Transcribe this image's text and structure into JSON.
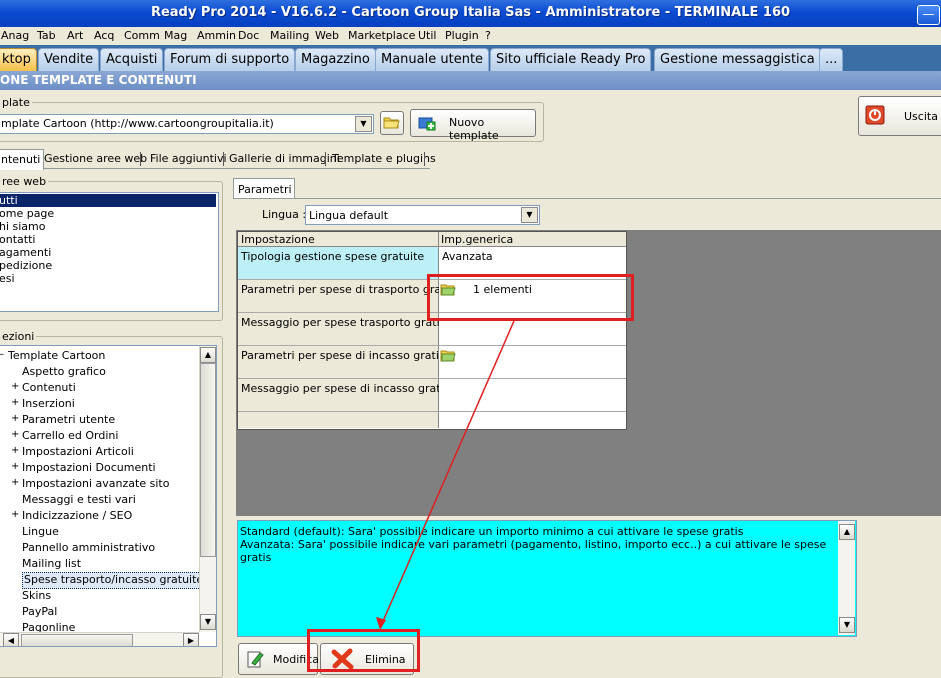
{
  "window": {
    "title": "Ready Pro 2014 - V16.6.2 - Cartoon Group Italia Sas - Amministratore - TERMINALE 160",
    "minimize_icon": "minimize-icon"
  },
  "menu": [
    "Anag",
    "Tab",
    "Art",
    "Acq",
    "Comm",
    "Mag",
    "Ammin",
    "Doc",
    "Mailing",
    "Web",
    "Marketplace",
    "Util",
    "Plugin",
    "?"
  ],
  "menu_accel": [
    "A",
    "T",
    "r",
    "q",
    "C",
    "M",
    "m",
    "D",
    "M",
    "W",
    "k",
    "U",
    "P",
    "?"
  ],
  "app_tabs": [
    "ktop",
    "Vendite",
    "Acquisti",
    "Forum di supporto",
    "Magazzino",
    "Manuale utente",
    "Sito ufficiale Ready Pro",
    "Gestione messaggistica",
    "..."
  ],
  "section_title": "ONE TEMPLATE E CONTENUTI",
  "template_group": {
    "legend": "plate",
    "combo_value": "mplate Cartoon (http://www.cartoongroupitalia.it)",
    "new_template_label": "Nuovo template"
  },
  "exit_label": "Uscita",
  "subtabs": [
    "ntenuti",
    "Gestione aree web",
    "File aggiuntivi",
    "Gallerie di immagini",
    "Template e plugins"
  ],
  "aree_web": {
    "legend": "ree web",
    "items": [
      "utti",
      "ome page",
      "hi siamo",
      "ontatti",
      "agamenti",
      "pedizione",
      "esi"
    ]
  },
  "sezioni": {
    "legend": "ezioni",
    "root": "Template Cartoon",
    "items": [
      {
        "label": "Aspetto grafico",
        "expandable": false
      },
      {
        "label": "Contenuti",
        "expandable": true
      },
      {
        "label": "Inserzioni",
        "expandable": true
      },
      {
        "label": "Parametri utente",
        "expandable": true
      },
      {
        "label": "Carrello ed Ordini",
        "expandable": true
      },
      {
        "label": "Impostazioni Articoli",
        "expandable": true
      },
      {
        "label": "Impostazioni Documenti",
        "expandable": true
      },
      {
        "label": "Impostazioni avanzate sito",
        "expandable": true
      },
      {
        "label": "Messaggi e testi vari",
        "expandable": false
      },
      {
        "label": "Indicizzazione / SEO",
        "expandable": true
      },
      {
        "label": "Lingue",
        "expandable": false
      },
      {
        "label": "Pannello amministrativo",
        "expandable": false
      },
      {
        "label": "Mailing list",
        "expandable": false
      },
      {
        "label": "Spese trasporto/incasso gratuite",
        "expandable": false
      },
      {
        "label": "Skins",
        "expandable": false
      },
      {
        "label": "PayPal",
        "expandable": false
      },
      {
        "label": "Pagonline",
        "expandable": false
      }
    ],
    "selected_index": 13
  },
  "parametri": {
    "tab_label": "Parametri",
    "lingua_label": "Lingua :",
    "lingua_value": "Lingua default",
    "col_headers": [
      "Impostazione",
      "Imp.generica"
    ],
    "rows": [
      {
        "label": "Tipologia gestione spese gratuite",
        "value": "Avanzata",
        "icon": false
      },
      {
        "label": "Parametri per spese di trasporto gratis",
        "value": "1 elementi",
        "icon": true
      },
      {
        "label": "Messaggio per spese trasporto gratis",
        "value": "",
        "icon": false
      },
      {
        "label": "Parametri per spese di incasso gratis",
        "value": "",
        "icon": true
      },
      {
        "label": "Messaggio per spese di incasso gratis",
        "value": "",
        "icon": false
      }
    ]
  },
  "description": {
    "line1": "Standard (default): Sara' possibile indicare un importo minimo a cui attivare le spese gratis",
    "line2": "Avanzata: Sara' possibile indicare vari parametri (pagamento, listino, importo ecc..) a cui attivare le spese gratis"
  },
  "bottom_buttons": {
    "modifica": "Modifica",
    "elimina": "Elimina"
  },
  "colors": {
    "titlebar": "#0a4bd1",
    "highlight_cell": "#bdf0f6",
    "description_bg": "#00ffff",
    "selected": "#0a246a",
    "annotation": "#e02020",
    "dark_panel": "#808080"
  }
}
